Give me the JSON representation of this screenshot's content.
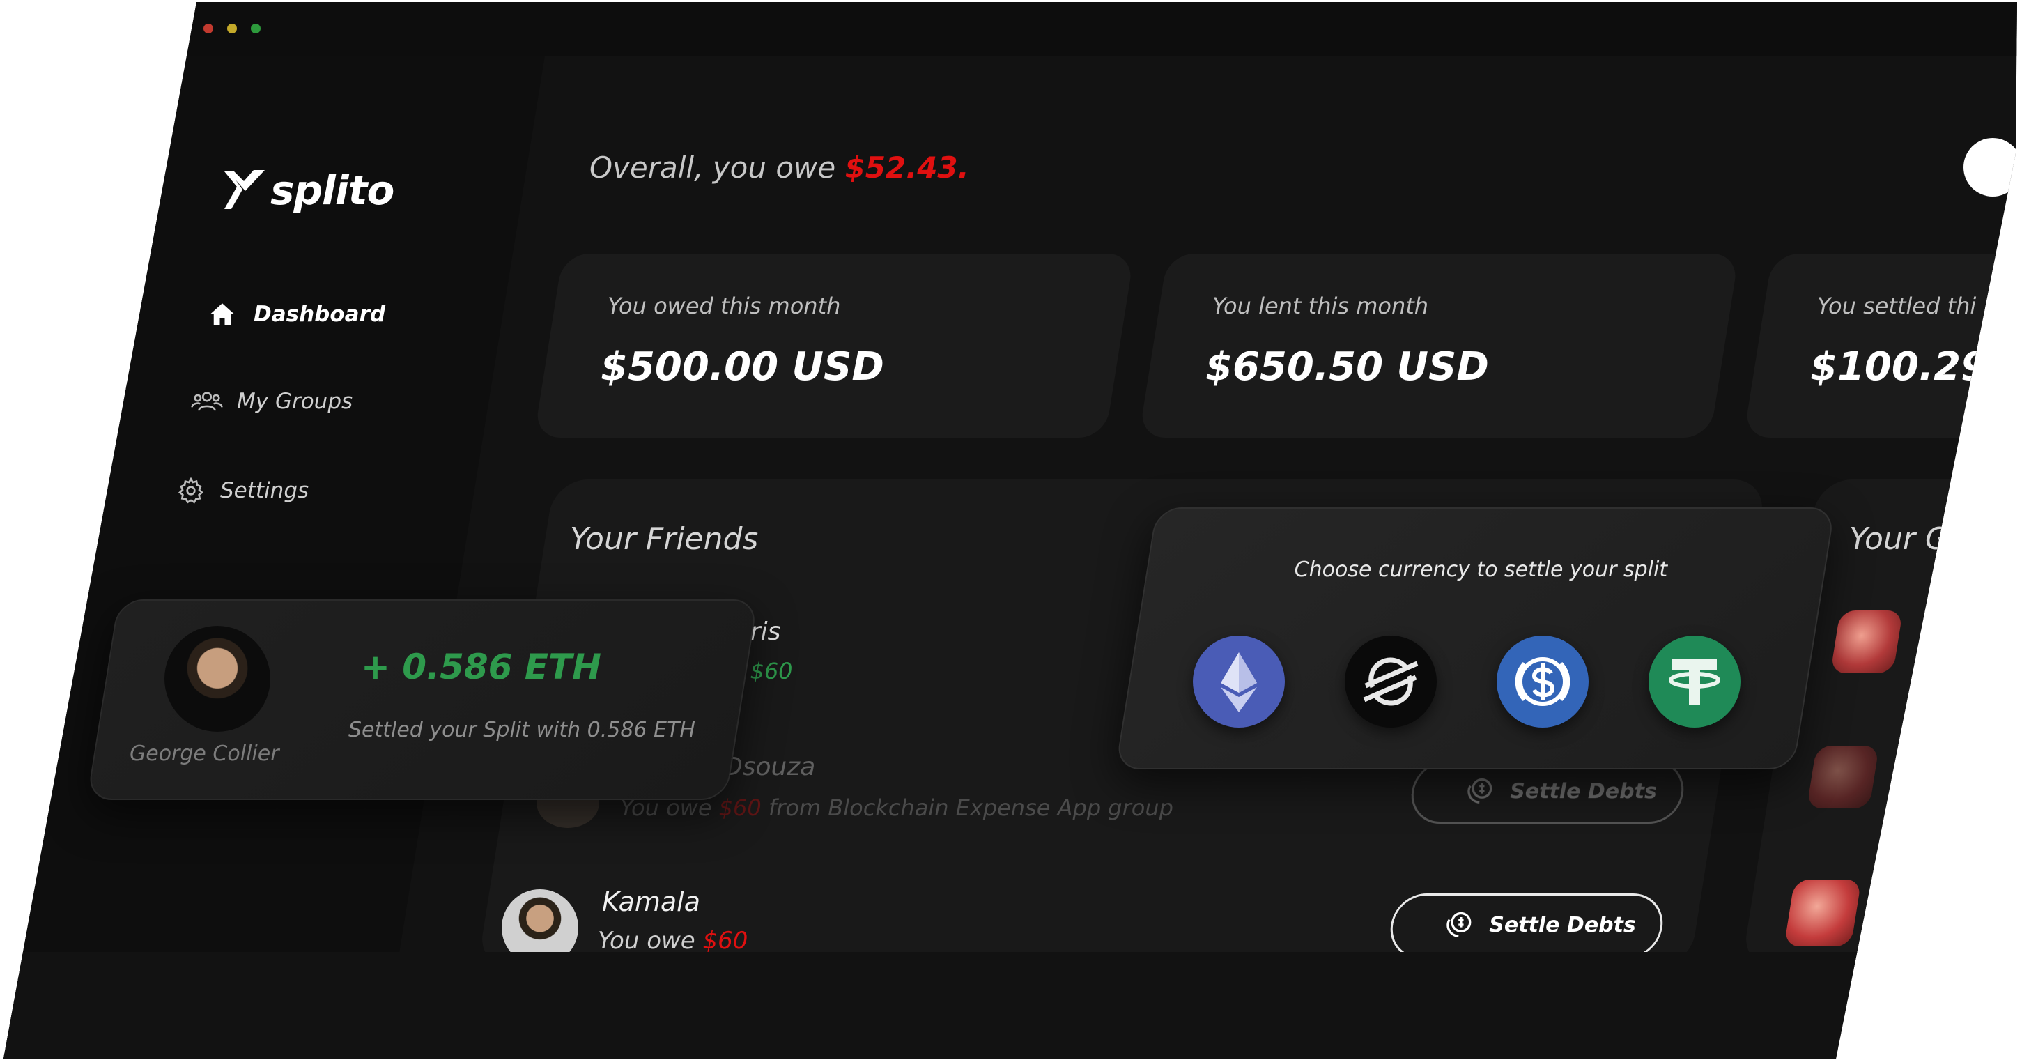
{
  "app": {
    "logo_text": "splito"
  },
  "colors": {
    "accent_red": "#e01010",
    "accent_green": "#2e9a4c",
    "background": "#121212",
    "card": "#1b1b1b"
  },
  "sidebar": {
    "items": [
      {
        "label": "Dashboard",
        "icon": "home-icon",
        "active": true
      },
      {
        "label": "My Groups",
        "icon": "groups-icon",
        "active": false
      },
      {
        "label": "Settings",
        "icon": "gear-icon",
        "active": false
      }
    ]
  },
  "header": {
    "prefix": "Overall, you owe ",
    "amount": "$52.43."
  },
  "stats": [
    {
      "label": "You owed this month",
      "value": "$500.00 USD"
    },
    {
      "label": "You lent this month",
      "value": "$650.50 USD"
    },
    {
      "label": "You settled thi",
      "value": "$100.29"
    }
  ],
  "friends": {
    "title": "Your Friends",
    "rows": [
      {
        "name": "rris",
        "owe_text": "u",
        "amount": "$60",
        "amount_color": "green"
      },
      {
        "name": "Dsouza",
        "owe_text": "You owe",
        "amount": "$60",
        "detail": "from Blockchain Expense App group",
        "button": "Settle Debts"
      },
      {
        "name": "Kamala",
        "owe_text": "You owe",
        "amount": "$60",
        "button": "Settle Debts"
      }
    ]
  },
  "groups_panel": {
    "title": "Your G"
  },
  "currency_popup": {
    "title": "Choose currency to settle your split",
    "currencies": [
      {
        "name": "Ethereum",
        "icon": "ethereum-icon",
        "color": "#4a5cb6"
      },
      {
        "name": "Stellar",
        "icon": "stellar-icon",
        "color": "#0a0a0a"
      },
      {
        "name": "USDC",
        "icon": "usdc-icon",
        "color": "#3365b8"
      },
      {
        "name": "Tether",
        "icon": "tether-icon",
        "color": "#1f8a57"
      }
    ]
  },
  "notification": {
    "user": "George Collier",
    "amount": "+ 0.586 ETH",
    "message": "Settled your Split with 0.586 ETH"
  }
}
